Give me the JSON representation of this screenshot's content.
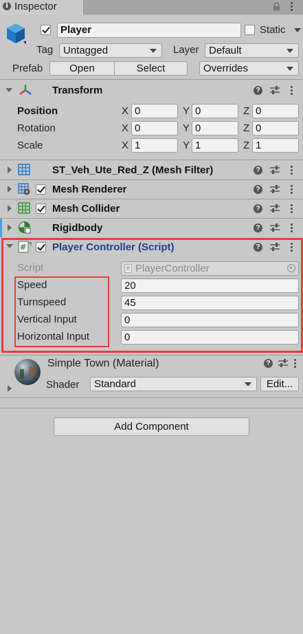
{
  "tab": {
    "label": "Inspector"
  },
  "object": {
    "name": "Player",
    "static_label": "Static",
    "active": true,
    "static": false
  },
  "tag": {
    "label": "Tag",
    "value": "Untagged"
  },
  "layer": {
    "label": "Layer",
    "value": "Default"
  },
  "prefab": {
    "label": "Prefab",
    "open": "Open",
    "select": "Select",
    "overrides": "Overrides"
  },
  "transform": {
    "title": "Transform",
    "rows": [
      {
        "label": "Position",
        "x": "0",
        "y": "0",
        "z": "0"
      },
      {
        "label": "Rotation",
        "x": "0",
        "y": "0",
        "z": "0"
      },
      {
        "label": "Scale",
        "x": "1",
        "y": "1",
        "z": "1"
      }
    ],
    "axis": {
      "x": "X",
      "y": "Y",
      "z": "Z"
    }
  },
  "components": [
    {
      "title": "ST_Veh_Ute_Red_Z (Mesh Filter)",
      "icon": "mesh-filter-icon"
    },
    {
      "title": "Mesh Renderer",
      "icon": "mesh-renderer-icon"
    },
    {
      "title": "Mesh Collider",
      "icon": "mesh-collider-icon"
    },
    {
      "title": "Rigidbody",
      "icon": "rigidbody-icon"
    }
  ],
  "script_component": {
    "title": "Player Controller (Script)",
    "script_label": "Script",
    "script_value": "PlayerController",
    "fields": [
      {
        "label": "Speed",
        "value": "20"
      },
      {
        "label": "Turnspeed",
        "value": "45"
      },
      {
        "label": "Vertical Input",
        "value": "0"
      },
      {
        "label": "Horizontal Input",
        "value": "0"
      }
    ]
  },
  "material": {
    "title": "Simple Town (Material)",
    "shader_label": "Shader",
    "shader_value": "Standard",
    "edit": "Edit..."
  },
  "add_component": "Add Component",
  "colors": {
    "script_title": "#1f3f8f",
    "highlight": "#ee3b3b"
  }
}
